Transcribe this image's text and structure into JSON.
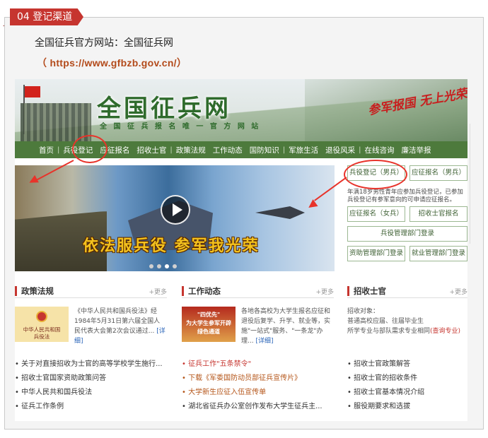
{
  "section_tag": "04 登记渠道",
  "intro_line": "全国征兵官方网站：全国征兵网",
  "url_line": "（ https://www.gfbzb.gov.cn/）",
  "site": {
    "title": "全国征兵网",
    "subtitle": "全 国 征 兵 报 名 唯 一 官 方 网 站",
    "slogan": "参军报国 无上光荣",
    "nav": [
      "首页",
      "兵役登记",
      "应征报名",
      "招收士官",
      "政策法规",
      "工作动态",
      "国防知识",
      "军旅生活",
      "退役风采",
      "在线咨询",
      "廉洁举报"
    ],
    "hero_slogan": "依法服兵役  参军我光荣",
    "side": {
      "btn_register_male": "兵役登记（男兵）",
      "btn_apply_male": "应征报名（男兵）",
      "note": "年满18岁男性青年应参加兵役登记，已参加兵役登记有参军意向的可申请应征报名。",
      "btn_apply_female": "应征报名（女兵）",
      "btn_nco": "招收士官报名",
      "btn_dept_login": "兵役管理部门登录",
      "btn_aid_login": "资助管理部门登录",
      "btn_employ_login": "就业管理部门登录"
    },
    "columns": [
      {
        "title": "政策法规",
        "more": "+更多",
        "image_text": "中华人民共和国\n兵役法",
        "feature": "《中华人民共和国兵役法》经1984年5月31日第六届全国人民代表大会第2次会议通过...",
        "feature_link": "[详细]",
        "items": [
          "• 关于对直接招收为士官的高等学校学生施行...",
          "• 招收士官国家资助政策问答",
          "• 中华人民共和国兵役法",
          "• 征兵工作条例"
        ]
      },
      {
        "title": "工作动态",
        "more": "+更多",
        "image_text": "\"四优先\"\n为大学生参军开辟\n绿色通道",
        "feature": "各地各高校为大学生报名应征和退役后复学、升学、就业等，实施\"一站式\"服务、\"一条龙\"办理...",
        "feature_link": "[详细]",
        "items": [
          "• 征兵工作\"五条禁令\"",
          "• 下载《军委国防动员部征兵宣传片》",
          "• 大学新生应征入伍宣传单",
          "• 湖北省征兵办公室创作发布大学生征兵主..."
        ]
      },
      {
        "title": "招收士官",
        "more": "+更多",
        "feature": "招收对象：\n普通高校应届、往届毕业生\n所学专业与部队需求专业相同",
        "feature_link": "(查询专业)",
        "items": [
          "• 招收士官政策解答",
          "• 招收士官的招收条件",
          "• 招收士官基本情况介绍",
          "• 服役期要求和选拔"
        ]
      }
    ]
  },
  "colors": {
    "accent": "#c6352f",
    "nav_green": "#4d7a3c",
    "annotation": "#e8332a"
  }
}
